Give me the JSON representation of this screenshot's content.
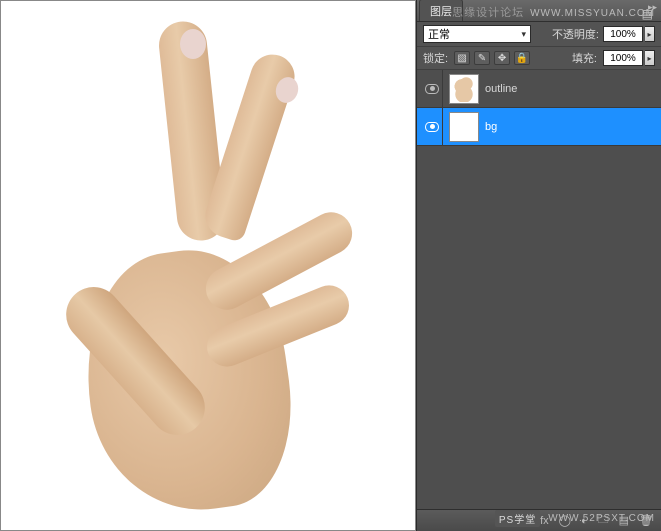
{
  "watermark_top": {
    "title": "思缘设计论坛",
    "url": "WWW.MISSYUAN.COM"
  },
  "watermark_bottom": {
    "badge": "PS学堂",
    "url": "WWW.52PSXT.COM"
  },
  "panel": {
    "tab_layers": "图层",
    "blend_mode": "正常",
    "opacity_label": "不透明度:",
    "opacity_value": "100%",
    "lock_label": "锁定:",
    "fill_label": "填充:",
    "fill_value": "100%",
    "lock_icons": {
      "transparent": "▧",
      "pixels": "✎",
      "position": "✥",
      "all": "🔒"
    },
    "layers": [
      {
        "name": "outline",
        "visible": true,
        "selected": false,
        "thumb": "hand"
      },
      {
        "name": "bg",
        "visible": true,
        "selected": true,
        "thumb": "white"
      }
    ],
    "footer_icons": {
      "link": "⧉",
      "fx": "fx",
      "mask": "◯",
      "adjust": "◐",
      "folder": "🗀",
      "new": "▤",
      "trash": "🗑"
    }
  }
}
